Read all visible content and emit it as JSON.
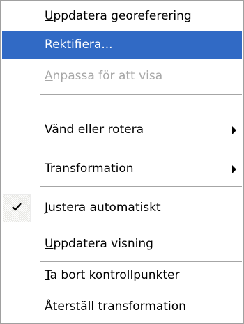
{
  "menu": {
    "items": [
      {
        "pre": "",
        "acc": "U",
        "post": "ppdatera georeferering"
      },
      {
        "pre": "",
        "acc": "R",
        "post": "ektifiera..."
      },
      {
        "pre": "",
        "acc": "A",
        "post": "npassa för att visa"
      },
      {
        "pre": "",
        "acc": "V",
        "post": "änd eller rotera"
      },
      {
        "pre": "",
        "acc": "T",
        "post": "ransformation"
      },
      {
        "pre": "",
        "acc": "J",
        "post": "ustera automatiskt"
      },
      {
        "pre": "",
        "acc": "U",
        "post": "ppdatera visning"
      },
      {
        "pre": "",
        "acc": "T",
        "post": "a bort kontrollpunkter"
      },
      {
        "pre": "Å",
        "acc": "t",
        "post": "erställ transformation"
      }
    ],
    "highlighted_index": 1,
    "disabled_index": 2,
    "checked_index": 5,
    "submenu_indices": [
      3,
      4
    ],
    "colors": {
      "highlight": "#316ac5",
      "disabled_text": "#a7a7a7",
      "separator": "#a6a6a6",
      "background": "#ffffff"
    },
    "icons": {
      "submenu": "submenu-arrow-icon",
      "check": "checkmark-icon"
    }
  }
}
